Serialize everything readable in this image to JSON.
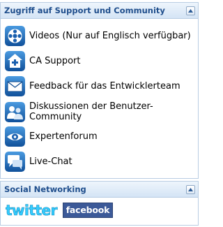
{
  "support_panel": {
    "title": "Zugriff auf Support und Community",
    "items": [
      {
        "label": "Videos (Nur auf Englisch verfügbar)",
        "icon": "video-reel-icon"
      },
      {
        "label": "CA Support",
        "icon": "support-house-icon"
      },
      {
        "label": "Feedback für das Entwicklerteam",
        "icon": "envelope-icon"
      },
      {
        "label": "Diskussionen der Benutzer-Community",
        "icon": "users-icon"
      },
      {
        "label": "Expertenforum",
        "icon": "expert-eye-icon"
      },
      {
        "label": "Live-Chat",
        "icon": "chat-bubble-icon"
      }
    ]
  },
  "social_panel": {
    "title": "Social Networking",
    "twitter_label": "twitter",
    "facebook_label": "facebook"
  },
  "colors": {
    "header_text": "#1f4e8c",
    "panel_border": "#b9cde3",
    "icon_blue": "#1e6bb8",
    "facebook_blue": "#3b5998",
    "twitter_blue": "#33ccff"
  }
}
